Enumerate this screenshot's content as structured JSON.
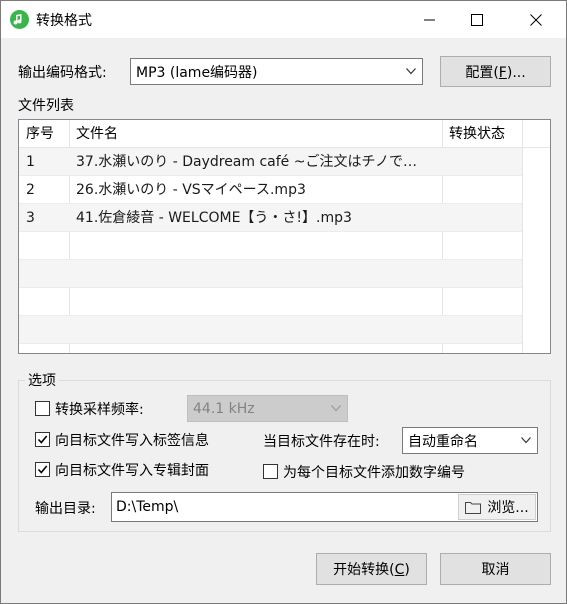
{
  "window": {
    "title": "转换格式",
    "icon": "music-note-icon"
  },
  "format": {
    "label": "输出编码格式:",
    "selected": "MP3 (lame编码器)",
    "config_button_prefix": "配置(",
    "config_button_key": "F",
    "config_button_suffix": ")..."
  },
  "file_list": {
    "label": "文件列表",
    "columns": [
      "序号",
      "文件名",
      "转换状态"
    ],
    "rows": [
      {
        "index": "1",
        "name": "37.水瀬いのり - Daydream café ~ご注文はチノで…",
        "status": ""
      },
      {
        "index": "2",
        "name": "26.水瀬いのり - VSマイペース.mp3",
        "status": ""
      },
      {
        "index": "3",
        "name": "41.佐倉綾音 - WELCOME【う・さ!】.mp3",
        "status": ""
      }
    ]
  },
  "options": {
    "group_title": "选项",
    "resample": {
      "label": "转换采样频率:",
      "checked": false,
      "value": "44.1 kHz"
    },
    "write_tags": {
      "label": "向目标文件写入标签信息",
      "checked": true
    },
    "write_cover": {
      "label": "向目标文件写入专辑封面",
      "checked": true
    },
    "exists": {
      "label": "当目标文件存在时:",
      "value": "自动重命名"
    },
    "numbering": {
      "label": "为每个目标文件添加数字编号",
      "checked": false
    },
    "output_dir": {
      "label": "输出目录:",
      "value": "D:\\Temp\\",
      "browse": "浏览..."
    }
  },
  "actions": {
    "start_prefix": "开始转换(",
    "start_key": "C",
    "start_suffix": ")",
    "cancel": "取消"
  },
  "colors": {
    "accent": "#3ab54a",
    "check": "#000000"
  }
}
